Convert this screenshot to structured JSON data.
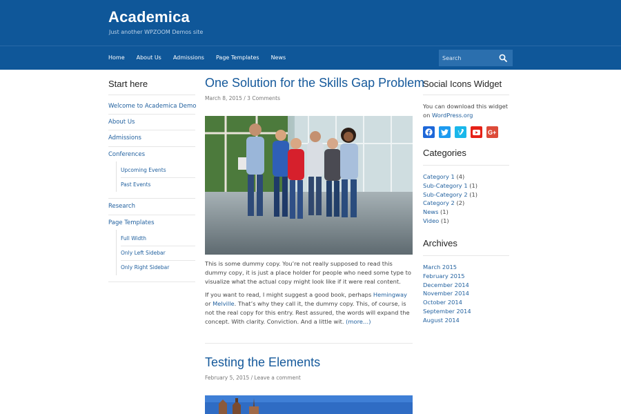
{
  "header": {
    "site_title": "Academica",
    "tagline": "Just another WPZOOM Demos site",
    "bg_color": "#0f5799",
    "nav": [
      "Home",
      "About Us",
      "Admissions",
      "Page Templates",
      "News"
    ],
    "search_placeholder": "Search",
    "search_icon": "search-icon"
  },
  "left_sidebar": {
    "title": "Start here",
    "items": [
      {
        "label": "Welcome to Academica Demo"
      },
      {
        "label": "About Us"
      },
      {
        "label": "Admissions"
      },
      {
        "label": "Conferences"
      },
      {
        "label": "Upcoming Events"
      },
      {
        "label": "Past Events"
      },
      {
        "label": "Research"
      },
      {
        "label": "Page Templates"
      },
      {
        "label": "Full Width"
      },
      {
        "label": "Only Left Sidebar"
      },
      {
        "label": "Only Right Sidebar"
      }
    ]
  },
  "posts": [
    {
      "title": "One Solution for the Skills Gap Problem",
      "date": "March 8, 2015",
      "sep": " / ",
      "comments": "3 Comments",
      "para1": "This is some dummy copy. You’re not really supposed to read this dummy copy, it is just a place holder for people who need some type to visualize what the actual copy might look like if it were real content.",
      "para2_a": "If you want to read, I might suggest a good book, perhaps ",
      "link_hemingway": "Hemingway",
      "para2_b": " or ",
      "link_melville": "Melville",
      "para2_c": ". That’s why they call it, the dummy copy. This, of course, is not the real copy for this entry. Rest assured, the words will expand the concept. With clarity. Conviction. And a little wit. ",
      "more": "(more…)"
    },
    {
      "title": "Testing the Elements",
      "date": "February 5, 2015",
      "sep": " / ",
      "comments": "Leave a comment"
    }
  ],
  "right_sidebar": {
    "social_title": "Social Icons Widget",
    "social_text_a": "You can download this widget on ",
    "social_link": "WordPress.org",
    "social_icons": [
      {
        "name": "facebook-icon",
        "color": "#1d67d8"
      },
      {
        "name": "twitter-icon",
        "color": "#1d9bf0"
      },
      {
        "name": "vimeo-icon",
        "color": "#1ab7ea"
      },
      {
        "name": "youtube-icon",
        "color": "#e62117"
      },
      {
        "name": "google-plus-icon",
        "color": "#dd4b39"
      }
    ],
    "categories_title": "Categories",
    "categories": [
      {
        "name": "Category 1",
        "count": " (4)"
      },
      {
        "name": "Sub-Category 1",
        "count": " (1)"
      },
      {
        "name": "Sub-Category 2",
        "count": " (1)"
      },
      {
        "name": "Category 2",
        "count": " (2)"
      },
      {
        "name": "News",
        "count": " (1)"
      },
      {
        "name": "Video",
        "count": " (1)"
      }
    ],
    "archives_title": "Archives",
    "archives": [
      "March 2015",
      "February 2015",
      "December 2014",
      "November 2014",
      "October 2014",
      "September 2014",
      "August 2014"
    ]
  }
}
